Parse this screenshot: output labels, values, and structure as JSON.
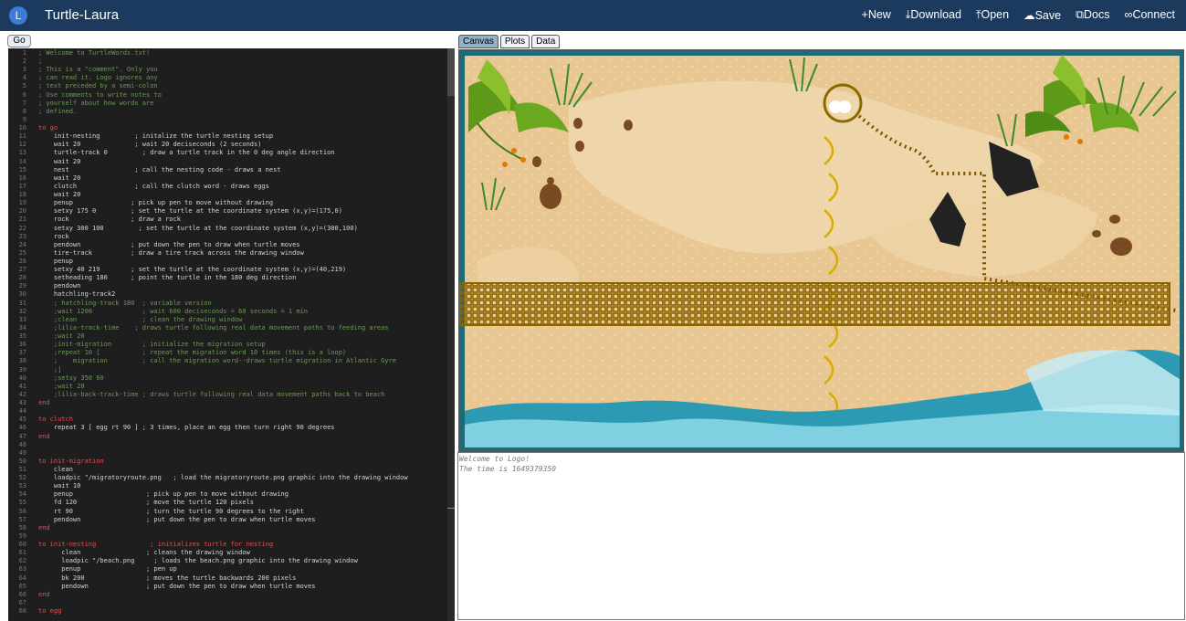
{
  "header": {
    "avatar_letter": "L",
    "title": "Turtle-Laura",
    "menu": [
      "New",
      "Download",
      "Open",
      "Save",
      "Docs",
      "Connect"
    ],
    "menu_icons": [
      "plus-icon",
      "download-icon",
      "open-icon",
      "cloud-save-icon",
      "docs-icon",
      "connect-icon"
    ]
  },
  "editor": {
    "go_label": "Go",
    "lines": [
      {
        "n": "1",
        "t": "; Welcome to TurtleWords.txt!"
      },
      {
        "n": "2",
        "t": ";"
      },
      {
        "n": "3",
        "t": "; This is a \"comment\". Only you"
      },
      {
        "n": "4",
        "t": "; can read it. Logo ignores any"
      },
      {
        "n": "5",
        "t": "; text preceded by a semi-colon"
      },
      {
        "n": "6",
        "t": "; Use comments to write notes to"
      },
      {
        "n": "7",
        "t": "; yourself about how words are"
      },
      {
        "n": "8",
        "t": "; defined."
      },
      {
        "n": "9",
        "t": ""
      },
      {
        "n": "10",
        "t": "to go"
      },
      {
        "n": "11",
        "t": "    init-nesting         ; initalize the turtle nesting setup"
      },
      {
        "n": "12",
        "t": "    wait 20              ; wait 20 deciseconds (2 seconds)"
      },
      {
        "n": "13",
        "t": "    turtle-track 0         ; draw a turtle track in the 0 deg angle direction"
      },
      {
        "n": "14",
        "t": "    wait 20"
      },
      {
        "n": "15",
        "t": "    nest                 ; call the nesting code - draws a nest"
      },
      {
        "n": "16",
        "t": "    wait 20"
      },
      {
        "n": "17",
        "t": "    clutch               ; call the clutch word - draws eggs"
      },
      {
        "n": "18",
        "t": "    wait 20"
      },
      {
        "n": "19",
        "t": "    penup               ; pick up pen to move without drawing"
      },
      {
        "n": "20",
        "t": "    setxy 175 0         ; set the turtle at the coordinate system (x,y)=(175,0)"
      },
      {
        "n": "21",
        "t": "    rock                ; draw a rock"
      },
      {
        "n": "22",
        "t": "    setxy 300 100         ; set the turtle at the coordinate system (x,y)=(300,100)"
      },
      {
        "n": "23",
        "t": "    rock"
      },
      {
        "n": "24",
        "t": "    pendown             ; put down the pen to draw when turtle moves"
      },
      {
        "n": "25",
        "t": "    tire-track          ; draw a tire track across the drawing window"
      },
      {
        "n": "26",
        "t": "    penup"
      },
      {
        "n": "27",
        "t": "    setxy 40 219        ; set the turtle at the coordinate system (x,y)=(40,219)"
      },
      {
        "n": "28",
        "t": "    setheading 180      ; point the turtle in the 180 deg direction"
      },
      {
        "n": "29",
        "t": "    pendown"
      },
      {
        "n": "30",
        "t": "    hatchling-track2"
      },
      {
        "n": "31",
        "t": "    ; hatchling-track 180  ; variable version"
      },
      {
        "n": "32",
        "t": "    ;wait 1200             ; wait 600 deciseconds = 60 seconds = 1 min"
      },
      {
        "n": "33",
        "t": "    ;clean                 ; clean the drawing window"
      },
      {
        "n": "34",
        "t": "    ;lilia-track-time    ; draws turtle following real data movement paths to feeding areas"
      },
      {
        "n": "35",
        "t": "    ;wait 20"
      },
      {
        "n": "36",
        "t": "    ;init-migration        ; initialize the migration setup"
      },
      {
        "n": "37",
        "t": "    ;repeat 10 [           ; repeat the migration word 10 times (this is a loop)"
      },
      {
        "n": "38",
        "t": "    ;    migration         ; call the migration word--draws turtle migration in Atlantic Gyre"
      },
      {
        "n": "39",
        "t": "    ;]"
      },
      {
        "n": "40",
        "t": "    ;setxy 350 60"
      },
      {
        "n": "41",
        "t": "    ;wait 20"
      },
      {
        "n": "42",
        "t": "    ;lilia-back-track-time ; draws turtle following real data movement paths back to beach"
      },
      {
        "n": "43",
        "t": "end"
      },
      {
        "n": "44",
        "t": ""
      },
      {
        "n": "45",
        "t": "to clutch"
      },
      {
        "n": "46",
        "t": "    repeat 3 [ egg rt 90 ] ; 3 times, place an egg then turn right 90 degrees"
      },
      {
        "n": "47",
        "t": "end"
      },
      {
        "n": "48",
        "t": ""
      },
      {
        "n": "49",
        "t": ""
      },
      {
        "n": "50",
        "t": "to init-migration"
      },
      {
        "n": "51",
        "t": "    clean"
      },
      {
        "n": "52",
        "t": "    loadpic \"/migratoryroute.png   ; load the migratoryroute.png graphic into the drawing window"
      },
      {
        "n": "53",
        "t": "    wait 10"
      },
      {
        "n": "54",
        "t": "    penup                   ; pick up pen to move without drawing"
      },
      {
        "n": "55",
        "t": "    fd 120                  ; move the turtle 120 pixels"
      },
      {
        "n": "56",
        "t": "    rt 90                   ; turn the turtle 90 degrees to the right"
      },
      {
        "n": "57",
        "t": "    pendown                 ; put down the pen to draw when turtle moves"
      },
      {
        "n": "58",
        "t": "end"
      },
      {
        "n": "59",
        "t": ""
      },
      {
        "n": "60",
        "t": "to init-nesting              ; initializes turtle for nesting"
      },
      {
        "n": "61",
        "t": "      clean                 ; cleans the drawing window"
      },
      {
        "n": "62",
        "t": "      loadpic \"/beach.png     ; loads the beach.png graphic into the drawing window"
      },
      {
        "n": "63",
        "t": "      penup                 ; pen up"
      },
      {
        "n": "64",
        "t": "      bk 200                ; moves the turtle backwards 200 pixels"
      },
      {
        "n": "65",
        "t": "      pendown               ; put down the pen to draw when turtle moves"
      },
      {
        "n": "66",
        "t": "end"
      },
      {
        "n": "67",
        "t": ""
      },
      {
        "n": "68",
        "t": "to egg"
      }
    ]
  },
  "view_tabs": [
    "Canvas",
    "Plots",
    "Data"
  ],
  "active_tab": "Canvas",
  "console": {
    "lines": [
      "Welcome to Logo!",
      "The time is 1649379350"
    ]
  },
  "colors": {
    "header_bg": "#1c3a5e",
    "sand": "#e7c48f",
    "track": "#7a5a00",
    "egg_arc": "#d9b400",
    "water": "#1f8fa8"
  }
}
